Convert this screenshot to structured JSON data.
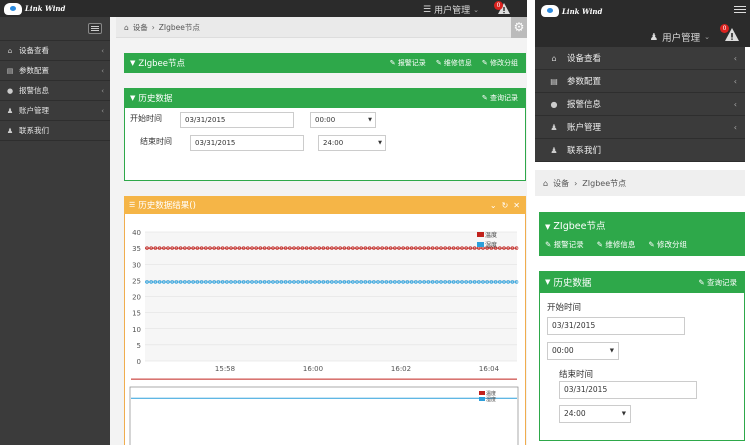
{
  "app": {
    "logo_text": "Link Wind",
    "user_menu": "用户管理",
    "alert_count": "0"
  },
  "sidebar": {
    "items": [
      {
        "label": "设备查看",
        "icon": "home-icon"
      },
      {
        "label": "参数配置",
        "icon": "file-icon"
      },
      {
        "label": "报警信息",
        "icon": "info-icon"
      },
      {
        "label": "账户管理",
        "icon": "user-icon"
      },
      {
        "label": "联系我们",
        "icon": "user-icon"
      }
    ]
  },
  "breadcrumb": {
    "home": "设备",
    "separator": "›",
    "current": "ZIgbee节点"
  },
  "node_panel": {
    "title": "ZIgbee节点",
    "links": [
      "报警记录",
      "维修信息",
      "修改分组"
    ]
  },
  "history_panel": {
    "title": "历史数据",
    "query_link": "查询记录",
    "start_label": "开始时间",
    "start_date": "03/31/2015",
    "start_time": "00:00",
    "end_label": "结束时间",
    "end_date": "03/31/2015",
    "end_time": "24:00"
  },
  "result_panel": {
    "title": "历史数据结果()"
  },
  "colors": {
    "green": "#2ea84a",
    "orange": "#f5b547",
    "temp": "#c0211c",
    "humid": "#2b9fdb",
    "dark": "#2b2b2b"
  },
  "chart_data": {
    "type": "line",
    "x": [
      "15:58",
      "16:00",
      "16:02",
      "16:04"
    ],
    "ylim": [
      0,
      40
    ],
    "yticks": [
      0,
      5,
      10,
      15,
      20,
      25,
      30,
      35,
      40
    ],
    "series": [
      {
        "name": "温度",
        "values": [
          35,
          35,
          35,
          35
        ]
      },
      {
        "name": "湿度",
        "values": [
          24.5,
          24.5,
          24.5,
          24.5
        ]
      }
    ],
    "legend": "top-right",
    "grid": true
  }
}
